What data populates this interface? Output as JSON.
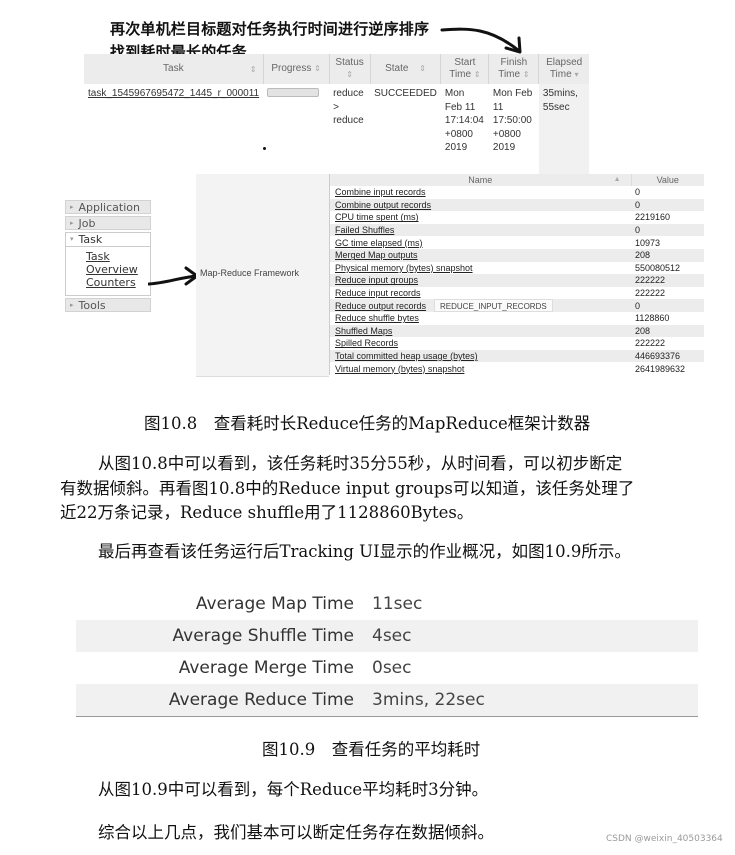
{
  "annotation": {
    "line1": "再次单机栏目标题对任务执行时间进行逆序排序",
    "line2": "找到耗时最长的任务"
  },
  "task_table": {
    "headers": [
      {
        "label": "Task",
        "sort": "⇕"
      },
      {
        "label": "Progress",
        "sort": "⇕"
      },
      {
        "label": "Status",
        "sort": "⇕"
      },
      {
        "label": "State",
        "sort": "⇕"
      },
      {
        "label": "Start Time",
        "sort": "⇕"
      },
      {
        "label": "Finish Time",
        "sort": "⇕"
      },
      {
        "label": "Elapsed Time",
        "sort": "▾"
      }
    ],
    "row": {
      "task": "task_1545967695472_1445_r_000011",
      "progress": 1.0,
      "status_lines": [
        "reduce",
        ">",
        "reduce"
      ],
      "state": "SUCCEEDED",
      "start_lines": [
        "Mon",
        "Feb 11",
        "17:14:04",
        "+0800",
        "2019"
      ],
      "finish_lines": [
        "Mon Feb",
        "11",
        "17:50:00",
        "+0800",
        "2019"
      ],
      "elapsed_lines": [
        "35mins,",
        "55sec"
      ]
    }
  },
  "nav": {
    "application": "Application",
    "job": "Job",
    "task": "Task",
    "task_links": [
      "Task",
      "Overview",
      "Counters"
    ],
    "tools": "Tools"
  },
  "counters": {
    "group": "Map-Reduce Framework",
    "header_name": "Name",
    "header_value": "Value",
    "tooltip": "REDUCE_INPUT_RECORDS",
    "rows": [
      {
        "name": "Combine input records",
        "value": "0"
      },
      {
        "name": "Combine output records",
        "value": "0"
      },
      {
        "name": "CPU time spent (ms)",
        "value": "2219160"
      },
      {
        "name": "Failed Shuffles",
        "value": "0"
      },
      {
        "name": "GC time elapsed (ms)",
        "value": "10973"
      },
      {
        "name": "Merged Map outputs",
        "value": "208"
      },
      {
        "name": "Physical memory (bytes) snapshot",
        "value": "550080512"
      },
      {
        "name": "Reduce input groups",
        "value": "222222"
      },
      {
        "name": "Reduce input records",
        "value": "222222"
      },
      {
        "name": "Reduce output records",
        "value": "0"
      },
      {
        "name": "Reduce shuffle bytes",
        "value": "1128860"
      },
      {
        "name": "Shuffled Maps",
        "value": "208"
      },
      {
        "name": "Spilled Records",
        "value": "222222"
      },
      {
        "name": "Total committed heap usage (bytes)",
        "value": "446693376"
      },
      {
        "name": "Virtual memory (bytes) snapshot",
        "value": "2641989632"
      }
    ]
  },
  "text": {
    "caption_10_8": "图10.8　查看耗时长Reduce任务的MapReduce框架计数器",
    "para1_line1": "从图10.8中可以看到，该任务耗时35分55秒，从时间看，可以初步断定",
    "para1_line2": "有数据倾斜。再看图10.8中的Reduce input groups可以知道，该任务处理了",
    "para1_line3": "近22万条记录，Reduce shuffle用了1128860Bytes。",
    "para2": "最后再查看该任务运行后Tracking UI显示的作业概况，如图10.9所示。",
    "caption_10_9": "图10.9　查看任务的平均耗时",
    "para3": "从图10.9中可以看到，每个Reduce平均耗时3分钟。",
    "para4": "综合以上几点，我们基本可以断定任务存在数据倾斜。",
    "watermark": "CSDN @weixin_40503364"
  },
  "averages": [
    {
      "label": "Average Map Time",
      "value": "11sec"
    },
    {
      "label": "Average Shuffle Time",
      "value": "4sec"
    },
    {
      "label": "Average Merge Time",
      "value": "0sec"
    },
    {
      "label": "Average Reduce Time",
      "value": "3mins, 22sec"
    }
  ]
}
